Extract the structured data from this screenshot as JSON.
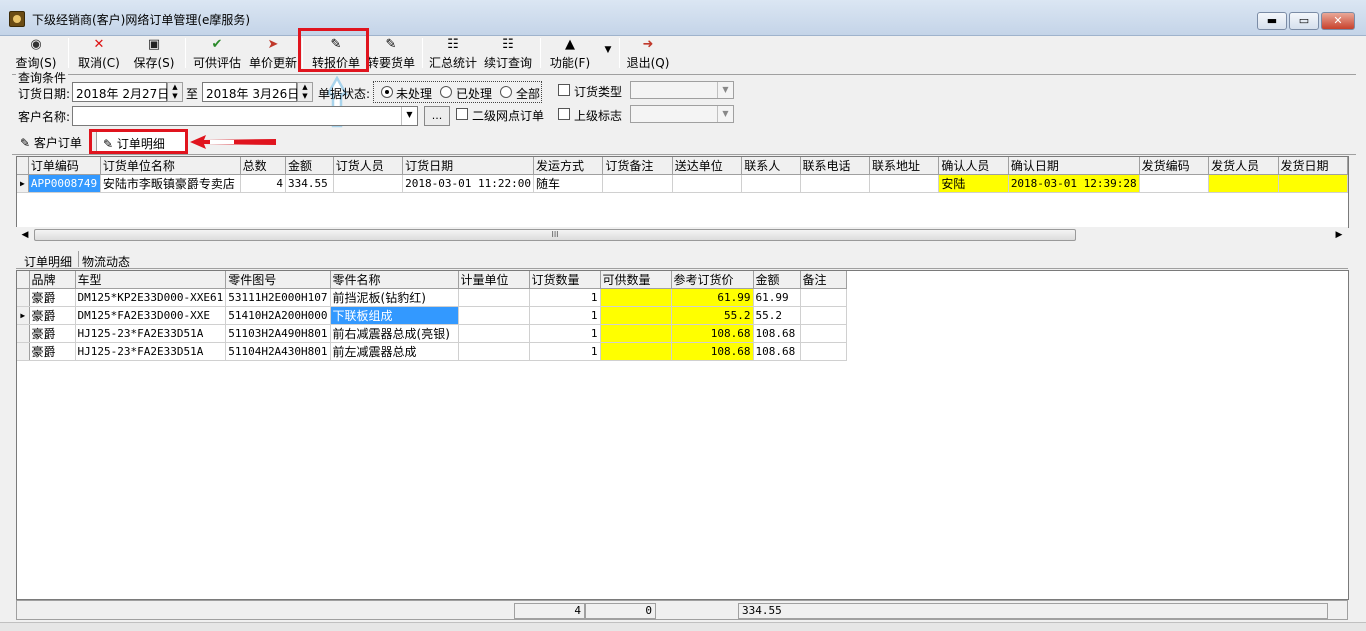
{
  "window": {
    "title": "下级经销商(客户)网络订单管理(e摩服务)",
    "controls": {
      "minimize": "▬",
      "maximize": "▭",
      "close": "✕"
    }
  },
  "toolbar": {
    "buttons": [
      {
        "label": "查询(S)",
        "icon": "binoculars-icon"
      },
      {
        "label": "取消(C)",
        "icon": "cancel-x-icon"
      },
      {
        "label": "保存(S)",
        "icon": "save-disk-icon"
      },
      {
        "label": "可供评估",
        "icon": "evaluate-icon"
      },
      {
        "label": "单价更新",
        "icon": "price-update-icon"
      },
      {
        "label": "转报价单",
        "icon": "quote-convert-icon"
      },
      {
        "label": "转要货单",
        "icon": "order-convert-icon"
      },
      {
        "label": "汇总统计",
        "icon": "summary-stats-icon"
      },
      {
        "label": "续订查询",
        "icon": "reorder-query-icon"
      },
      {
        "label": "功能(F)",
        "icon": "bank-building-icon"
      },
      {
        "label": "退出(Q)",
        "icon": "exit-door-icon"
      }
    ],
    "dropdown_glyph": "▼"
  },
  "query": {
    "legend": "查询条件",
    "order_date_label": "订货日期:",
    "date_from": "2018年  2月27日",
    "to_label": "至",
    "date_to": "2018年  3月26日",
    "status_label": "单据状态:",
    "status_options": [
      "未处理",
      "已处理",
      "全部"
    ],
    "status_selected": 0,
    "order_type_label": "订货类型",
    "customer_label": "客户名称:",
    "customer_value": "",
    "browse_label": "...",
    "secondary_outlet_label": "二级网点订单",
    "superior_flag_label": "上级标志"
  },
  "tabs": [
    {
      "label": "客户订单",
      "icon": "order-edit-icon"
    },
    {
      "label": "订单明细",
      "icon": "order-detail-icon"
    }
  ],
  "orders_grid": {
    "columns": [
      "订单编码",
      "订货单位名称",
      "总数",
      "金额",
      "订货人员",
      "订货日期",
      "发运方式",
      "订货备注",
      "送达单位",
      "联系人",
      "联系电话",
      "联系地址",
      "确认人员",
      "确认日期",
      "发货编码",
      "发货人员",
      "发货日期"
    ],
    "rows": [
      {
        "code": "APP0008749",
        "unit": "安陆市李畈镇豪爵专卖店",
        "total": "4",
        "amount": "334.55",
        "orderer": "",
        "order_date": "2018-03-01 11:22:00",
        "shipping": "随车",
        "remark": "",
        "deliver_to": "",
        "contact": "",
        "phone": "",
        "address": "",
        "confirmer": "安陆",
        "confirm_date": "2018-03-01 12:39:28",
        "ship_code": "",
        "shipper": "",
        "ship_date": ""
      }
    ]
  },
  "scrollbar": {
    "left": "◀",
    "right": "▶",
    "grip": "III"
  },
  "subtabs": [
    "订单明细",
    "物流动态"
  ],
  "detail_grid": {
    "columns": [
      "品牌",
      "车型",
      "零件图号",
      "零件名称",
      "计量单位",
      "订货数量",
      "可供数量",
      "参考订货价",
      "金额",
      "备注"
    ],
    "rows": [
      {
        "brand": "豪爵",
        "model": "DM125*KP2E33D000-XXE61",
        "part_no": "53111H2E000H107",
        "part_name": "前挡泥板(钻豹红)",
        "unit": "",
        "qty": "1",
        "avail": "",
        "price": "61.99",
        "amount": "61.99",
        "note": ""
      },
      {
        "brand": "豪爵",
        "model": "DM125*FA2E33D000-XXE",
        "part_no": "51410H2A200H000",
        "part_name": "下联板组成",
        "unit": "",
        "qty": "1",
        "avail": "",
        "price": "55.2",
        "amount": "55.2",
        "note": ""
      },
      {
        "brand": "豪爵",
        "model": "HJ125-23*FA2E33D51A",
        "part_no": "51103H2A490H801",
        "part_name": "前右减震器总成(亮银)",
        "unit": "",
        "qty": "1",
        "avail": "",
        "price": "108.68",
        "amount": "108.68",
        "note": ""
      },
      {
        "brand": "豪爵",
        "model": "HJ125-23*FA2E33D51A",
        "part_no": "51104H2A430H801",
        "part_name": "前左减震器总成",
        "unit": "",
        "qty": "1",
        "avail": "",
        "price": "108.68",
        "amount": "108.68",
        "note": ""
      }
    ]
  },
  "footer": {
    "qty_total": "4",
    "avail_total": "0",
    "amount_total": "334.55"
  },
  "colors": {
    "highlight": "#ffff00",
    "annotation_red": "#e0141e",
    "annotation_arrow": "#a9d4ec",
    "selection": "#3399ff"
  }
}
